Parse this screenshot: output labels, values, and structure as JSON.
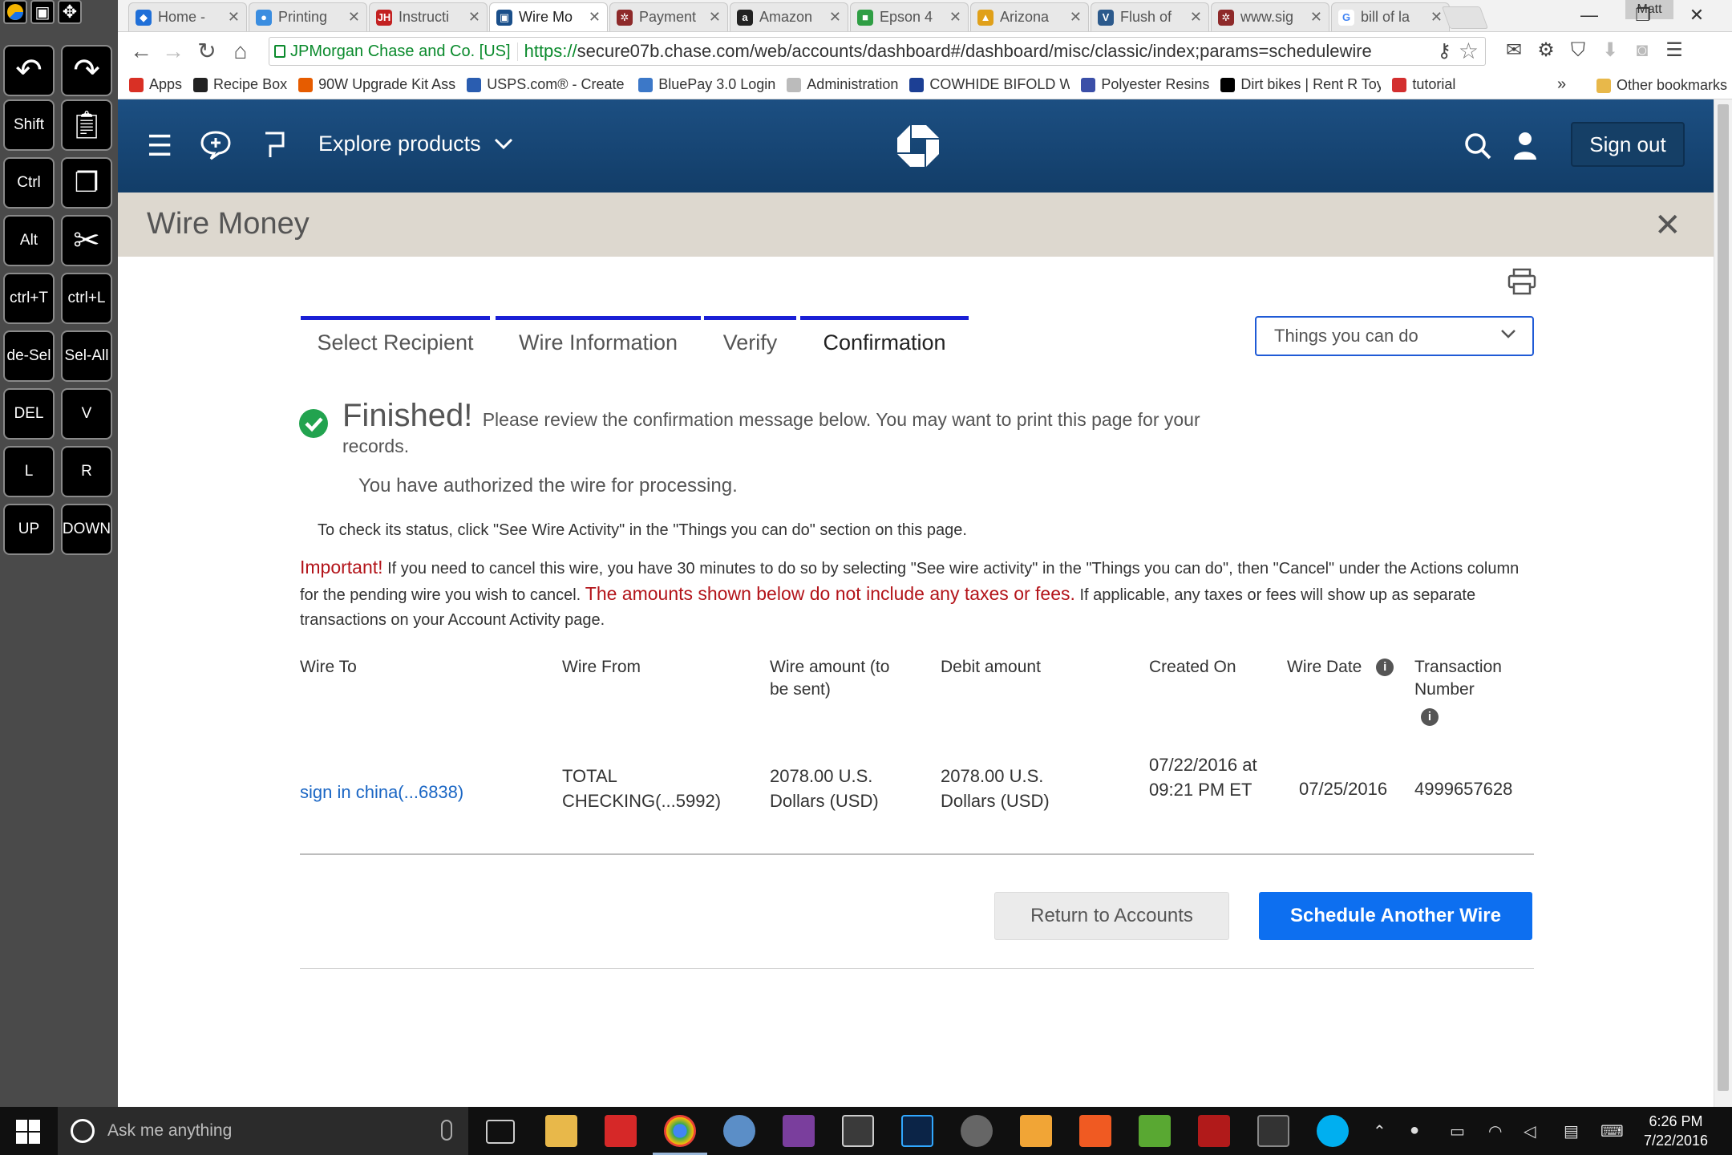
{
  "browser": {
    "tabs": [
      {
        "label": "Home -",
        "color": "#1f6fd8",
        "glyph": "◆",
        "active": false
      },
      {
        "label": "Printing",
        "color": "#3a8de0",
        "glyph": "●",
        "active": false
      },
      {
        "label": "Instructi",
        "color": "#c32121",
        "glyph": "JH",
        "active": false
      },
      {
        "label": "Wire Mo",
        "color": "#1a4f8a",
        "glyph": "▣",
        "active": true
      },
      {
        "label": "Payment",
        "color": "#8e2a2a",
        "glyph": "✲",
        "active": false
      },
      {
        "label": "Amazon",
        "color": "#222222",
        "glyph": "a",
        "active": false
      },
      {
        "label": "Epson 4",
        "color": "#2f9e44",
        "glyph": "■",
        "active": false
      },
      {
        "label": "Arizona",
        "color": "#e0a019",
        "glyph": "▲",
        "active": false
      },
      {
        "label": "Flush of",
        "color": "#2c5a8c",
        "glyph": "V",
        "active": false
      },
      {
        "label": "www.sig",
        "color": "#8e2a2a",
        "glyph": "✲",
        "active": false
      },
      {
        "label": "bill of la",
        "color": "#ffffff",
        "glyph": "G",
        "active": false
      }
    ],
    "profile_name": "Matt",
    "window_buttons": [
      "—",
      "❐",
      "✕"
    ],
    "site_identity": "JPMorgan Chase and Co. [US]",
    "url_scheme": "https://",
    "url_rest": "secure07b.chase.com/web/accounts/dashboard#/dashboard/misc/classic/index;params=schedulewire",
    "bookmarks": [
      {
        "label": "Apps",
        "color": "#d93025"
      },
      {
        "label": "Recipe Box",
        "color": "#222222"
      },
      {
        "label": "90W Upgrade Kit Ass",
        "color": "#e65c00"
      },
      {
        "label": "USPS.com® - Create S",
        "color": "#2a5db0"
      },
      {
        "label": "BluePay 3.0 Login",
        "color": "#3c78c8"
      },
      {
        "label": "Administration",
        "color": "#bbbbbb"
      },
      {
        "label": "COWHIDE BIFOLD WA",
        "color": "#1c3f94"
      },
      {
        "label": "Polyester Resins",
        "color": "#3b4fa8"
      },
      {
        "label": "Dirt bikes | Rent R Toy",
        "color": "#000000"
      },
      {
        "label": "tutorial",
        "color": "#d32f2f"
      }
    ],
    "other_bookmarks": "Other bookmarks",
    "more_bookmarks": "»"
  },
  "keyboard_panel": {
    "keys": [
      "Shift",
      "Ctrl",
      "Alt",
      "ctrl+T",
      "ctrl+L",
      "de-Sel",
      "Sel-All",
      "DEL",
      "V",
      "L",
      "R",
      "UP",
      "DOWN"
    ]
  },
  "header": {
    "explore_label": "Explore products",
    "signout_label": "Sign out"
  },
  "titlebar": {
    "title": "Wire Money"
  },
  "steps": [
    {
      "label": "Select Recipient"
    },
    {
      "label": "Wire Information"
    },
    {
      "label": "Verify"
    },
    {
      "label": "Confirmation"
    }
  ],
  "things_dropdown": {
    "label": "Things you can do"
  },
  "confirmation": {
    "finished_big": "Finished!",
    "finished_text": "Please review the confirmation message below. You may want to print this page for your records.",
    "authorized": "You have authorized the wire for processing.",
    "status_note": "To check its status, click \"See Wire Activity\" in the \"Things you can do\" section on this page.",
    "important_label": "Important!",
    "important_text": "If you need to cancel this wire, you have 30 minutes to do so by selecting \"See wire activity\" in the \"Things you can do\", then \"Cancel\" under the Actions column for the pending wire you wish to cancel.",
    "fees_warning": "The amounts shown below do not include any taxes or fees.",
    "fees_note": "If applicable, any taxes or fees will show up as separate transactions on your Account Activity page."
  },
  "table": {
    "headers": {
      "wire_to": "Wire To",
      "wire_from": "Wire From",
      "wire_amount": "Wire amount (to be sent)",
      "debit_amount": "Debit amount",
      "created_on": "Created On",
      "wire_date": "Wire Date",
      "transaction_number": "Transaction Number"
    },
    "row": {
      "wire_to": "sign in china(...6838)",
      "wire_from": "TOTAL CHECKING(...5992)",
      "wire_amount": "2078.00 U.S. Dollars (USD)",
      "debit_amount": "2078.00 U.S. Dollars (USD)",
      "created_on": "07/22/2016 at 09:21 PM ET",
      "wire_date": "07/25/2016",
      "transaction_number": "4999657628"
    }
  },
  "buttons": {
    "return_label": "Return to Accounts",
    "schedule_label": "Schedule Another Wire"
  },
  "taskbar": {
    "search_placeholder": "Ask me anything",
    "time": "6:26 PM",
    "date": "7/22/2016"
  }
}
